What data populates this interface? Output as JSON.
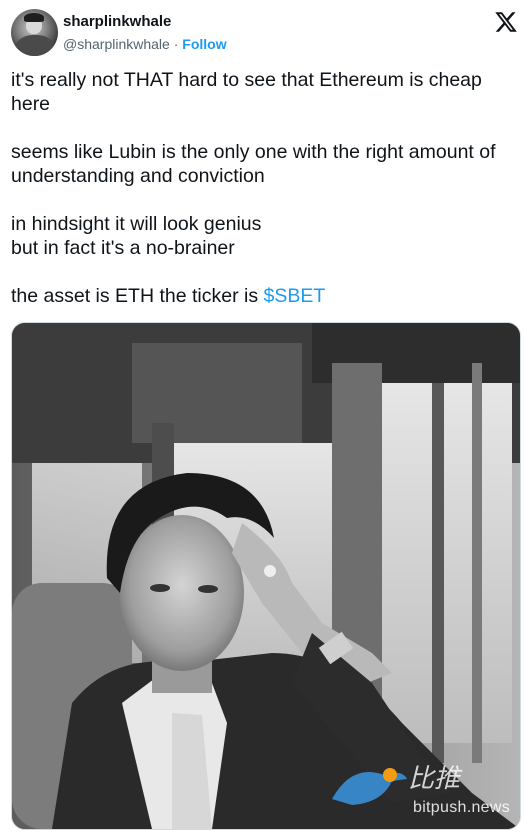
{
  "author": {
    "display_name": "sharplinkwhale",
    "handle": "@sharplinkwhale",
    "separator": "·",
    "follow_label": "Follow"
  },
  "logo_icon": "x-logo-icon",
  "tweet": {
    "para1": "it's really not THAT hard to see that  Ethereum is cheap here",
    "para2": "seems like Lubin is the only one with the right amount of understanding and conviction",
    "para3_line1": "in hindsight it will look genius",
    "para3_line2": "but in fact it's a no-brainer",
    "para4_prefix": "the asset is ETH the ticker is ",
    "para4_ticker": "$SBET"
  },
  "watermark": {
    "cn_text": "比推",
    "site_text": "bitpush.news"
  },
  "colors": {
    "link": "#1d9bf0",
    "text": "#0f1419",
    "muted": "#536471"
  }
}
